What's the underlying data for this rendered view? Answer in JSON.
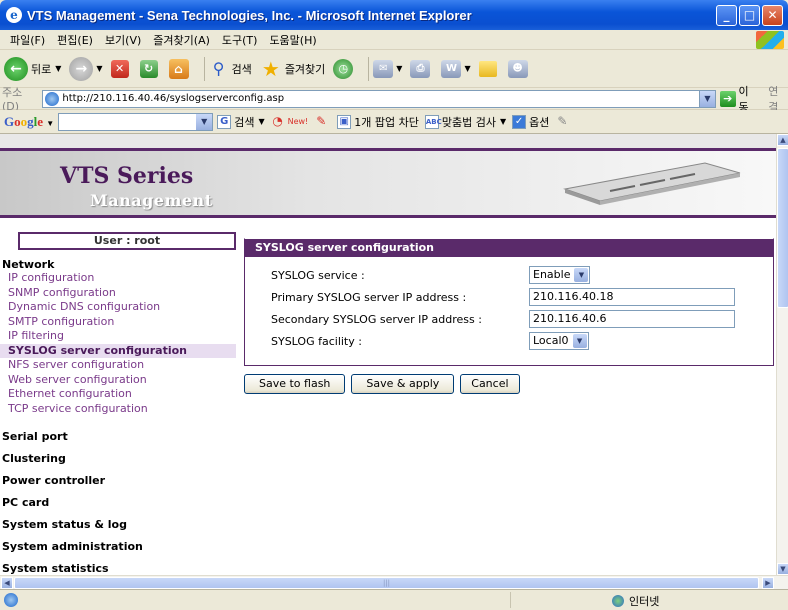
{
  "window": {
    "title": "VTS Management - Sena Technologies, Inc. - Microsoft Internet Explorer"
  },
  "menu": [
    "파일(F)",
    "편집(E)",
    "보기(V)",
    "즐겨찾기(A)",
    "도구(T)",
    "도움말(H)"
  ],
  "toolbar": {
    "back": "뒤로",
    "search": "검색",
    "favorites": "즐겨찾기"
  },
  "address": {
    "label": "주소(D)",
    "url": "http://210.116.40.46/syslogserverconfig.asp",
    "go": "이동",
    "links": "연결"
  },
  "googlebar": {
    "logo": "Google",
    "search_btn": "검색",
    "new_badge": "New!",
    "popup_blocked": "1개 팝업 차단",
    "spellcheck": "맞춤법 검사",
    "options": "옵션"
  },
  "page": {
    "brand": "VTS Series",
    "brand_sub": "Management",
    "user": "User : root",
    "nav": {
      "network": {
        "title": "Network",
        "items": [
          "IP configuration",
          "SNMP configuration",
          "Dynamic DNS configuration",
          "SMTP configuration",
          "IP filtering",
          "SYSLOG server configuration",
          "NFS server configuration",
          "Web server configuration",
          "Ethernet configuration",
          "TCP service configuration"
        ]
      },
      "sections": [
        "Serial port",
        "Clustering",
        "Power controller",
        "PC card",
        "System status & log",
        "System administration",
        "System statistics"
      ]
    },
    "panel": {
      "title": "SYSLOG server configuration",
      "rows": [
        {
          "label": "SYSLOG service :",
          "value": "Enable"
        },
        {
          "label": "Primary SYSLOG server IP address :",
          "value": "210.116.40.18"
        },
        {
          "label": "Secondary SYSLOG server IP address :",
          "value": "210.116.40.6"
        },
        {
          "label": "SYSLOG facility :",
          "value": "Local0"
        }
      ]
    },
    "buttons": {
      "save_flash": "Save to flash",
      "save_apply": "Save & apply",
      "cancel": "Cancel"
    }
  },
  "status": {
    "zone": "인터넷"
  }
}
